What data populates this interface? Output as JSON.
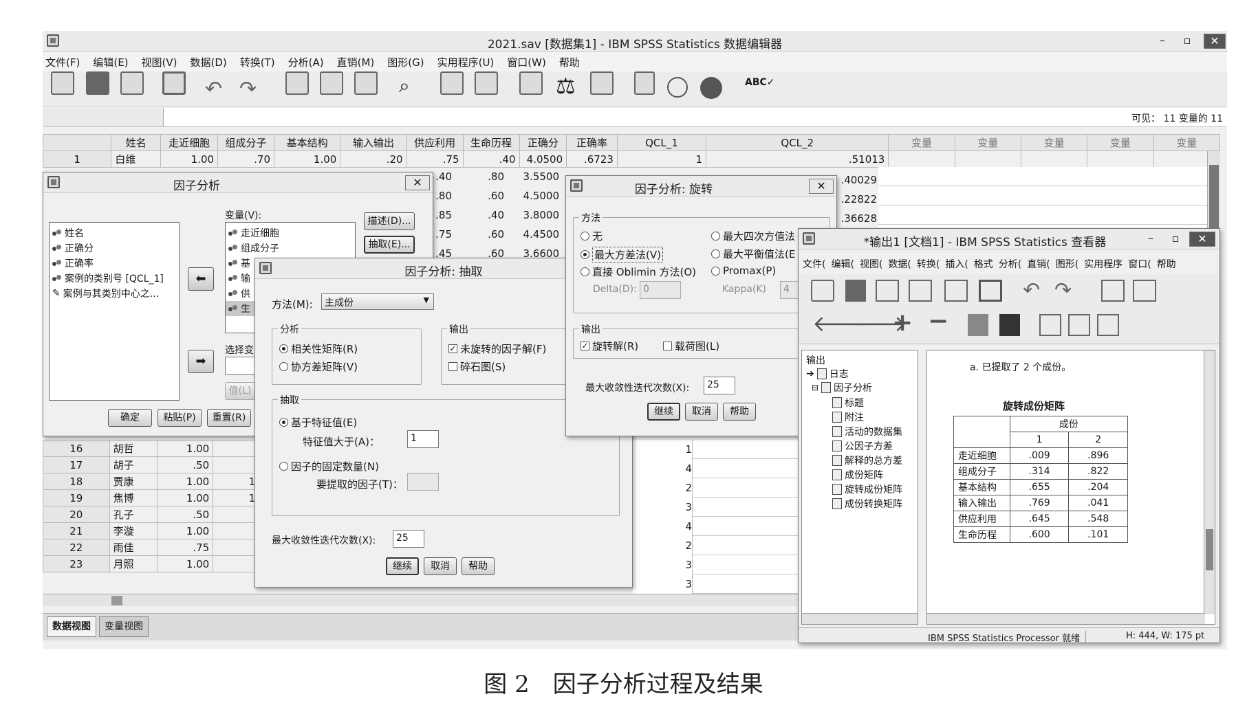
{
  "main": {
    "title": "2021.sav [数据集1] - IBM SPSS Statistics 数据编辑器",
    "menu": [
      "文件(F)",
      "编辑(E)",
      "视图(V)",
      "数据(D)",
      "转换(T)",
      "分析(A)",
      "直销(M)",
      "图形(G)",
      "实用程序(U)",
      "窗口(W)",
      "帮助"
    ],
    "visible_vars": "可见： 11 变量的 11",
    "columns": [
      "姓名",
      "走近细胞",
      "组成分子",
      "基本结构",
      "输入输出",
      "供应利用",
      "生命历程",
      "正确分",
      "正确率",
      "QCL_1",
      "QCL_2",
      "变量",
      "变量",
      "变量",
      "变量",
      "变量"
    ],
    "row1": [
      "1",
      "白维",
      "1.00",
      ".70",
      "1.00",
      ".20",
      ".75",
      ".40",
      "4.0500",
      ".6723",
      "1",
      ".51013"
    ],
    "partial_rows": [
      [
        ".40",
        ".80",
        "3.5500",
        ".40029"
      ],
      [
        ".80",
        ".60",
        "4.5000",
        ".22822"
      ],
      [
        ".85",
        ".40",
        "3.8000",
        ".36628"
      ],
      [
        ".75",
        ".60",
        "4.4500"
      ],
      [
        ".45",
        ".60",
        "3.6600"
      ]
    ],
    "lower_rows": [
      {
        "n": "16",
        "name": "胡哲",
        "v": "1.00",
        "c": "",
        "q": "1"
      },
      {
        "n": "17",
        "name": "胡子",
        "v": ".50",
        "c": "",
        "q": "4"
      },
      {
        "n": "18",
        "name": "贾康",
        "v": "1.00",
        "c": "1",
        "q": "2"
      },
      {
        "n": "19",
        "name": "焦博",
        "v": "1.00",
        "c": "1",
        "q": "3"
      },
      {
        "n": "20",
        "name": "孔子",
        "v": ".50",
        "c": "",
        "q": "4"
      },
      {
        "n": "21",
        "name": "李漩",
        "v": "1.00",
        "c": "",
        "q": "2"
      },
      {
        "n": "22",
        "name": "雨佳",
        "v": ".75",
        "c": "",
        "q": "3"
      },
      {
        "n": "23",
        "name": "月照",
        "v": "1.00",
        "c": "",
        "q": "3"
      }
    ],
    "tabs": [
      "数据视图",
      "变量视图"
    ]
  },
  "factor": {
    "title": "因子分析",
    "source_vars": [
      "姓名",
      "正确分",
      "正确率",
      "案例的类别号 [QCL_1]",
      "案例与其类别中心之..."
    ],
    "vars_label": "变量(V):",
    "selected_vars": [
      "走近细胞",
      "组成分子",
      "基",
      "输",
      "供",
      "生"
    ],
    "select_label": "选择变",
    "value_btn": "值(L)",
    "side_buttons": [
      "描述(D)...",
      "抽取(E)..."
    ],
    "ok": "确定",
    "paste": "粘贴(P)",
    "reset": "重置(R)"
  },
  "extract": {
    "title": "因子分析: 抽取",
    "method_label": "方法(M):",
    "method_value": "主成份",
    "analyze_label": "分析",
    "corr": "相关性矩阵(R)",
    "cov": "协方差矩阵(V)",
    "output_label": "输出",
    "unrotated": "未旋转的因子解(F)",
    "scree": "碎石图(S)",
    "extract_label": "抽取",
    "eigen": "基于特征值(E)",
    "eigen_gt": "特征值大于(A)：",
    "eigen_value": "1",
    "fixed": "因子的固定数量(N)",
    "to_extract": "要提取的因子(T)：",
    "iter_label": "最大收敛性迭代次数(X):",
    "iter_value": "25",
    "continue": "继续",
    "cancel": "取消",
    "help": "帮助"
  },
  "rotate": {
    "title": "因子分析: 旋转",
    "method_label": "方法",
    "none": "无",
    "quartimax": "最大四次方值法",
    "varimax": "最大方差法(V)",
    "equamax": "最大平衡值法(E",
    "oblimin": "直接 Oblimin 方法(O)",
    "promax": "Promax(P)",
    "delta_label": "Delta(D):",
    "delta_value": "0",
    "kappa_label": "Kappa(K)",
    "kappa_value": "4",
    "output_label": "输出",
    "rotated": "旋转解(R)",
    "loading": "载荷图(L)",
    "iter_label": "最大收敛性迭代次数(X):",
    "iter_value": "25",
    "continue": "继续",
    "cancel": "取消",
    "help": "帮助"
  },
  "viewer": {
    "title": "*输出1 [文档1] - IBM SPSS Statistics 查看器",
    "menu": [
      "文件(",
      "编辑(",
      "视图(",
      "数据(",
      "转换(",
      "插入(",
      "格式",
      "分析(",
      "直销(",
      "图形(",
      "实用程序",
      "窗口(",
      "帮助"
    ],
    "tree": [
      "输出",
      "日志",
      "因子分析",
      "标题",
      "附注",
      "活动的数据集",
      "公因子方差",
      "解释的总方差",
      "成份矩阵",
      "旋转成份矩阵",
      "成份转换矩阵"
    ],
    "note": "a. 已提取了 2 个成份。",
    "table_title": "旋转成份矩阵",
    "component_header": "成份",
    "col1": "1",
    "col2": "2",
    "rows": [
      {
        "label": "走近细胞",
        "c1": ".009",
        "c2": ".896"
      },
      {
        "label": "组成分子",
        "c1": ".314",
        "c2": ".822"
      },
      {
        "label": "基本结构",
        "c1": ".655",
        "c2": ".204"
      },
      {
        "label": "输入输出",
        "c1": ".769",
        "c2": ".041"
      },
      {
        "label": "供应利用",
        "c1": ".645",
        "c2": ".548"
      },
      {
        "label": "生命历程",
        "c1": ".600",
        "c2": ".101"
      }
    ],
    "status": "IBM SPSS Statistics Processor 就绪",
    "size": "H: 444, W: 175 pt"
  },
  "caption": "图 2　因子分析过程及结果"
}
